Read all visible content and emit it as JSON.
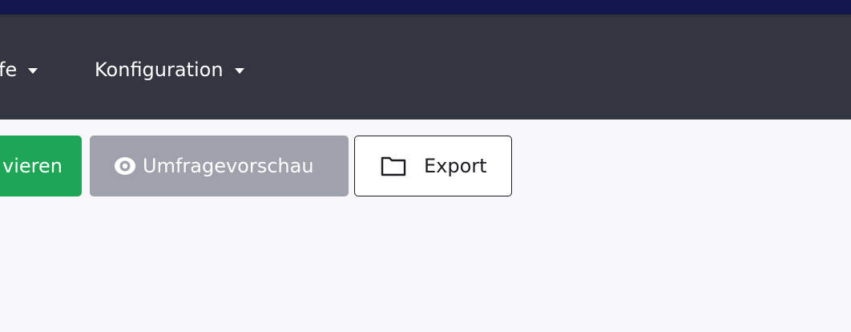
{
  "navbar": {
    "items": [
      {
        "label": "fe"
      },
      {
        "label": "Konfiguration"
      }
    ]
  },
  "toolbar": {
    "activate_label": "vieren",
    "preview_label": "Umfragevorschau",
    "export_label": "Export"
  },
  "colors": {
    "topbar": "#14164f",
    "navbar": "#333641",
    "activate": "#1ea657",
    "preview": "#9fa2ad",
    "background": "#f8f8fb"
  },
  "icons": {
    "preview": "eye-icon",
    "export": "folder-icon",
    "dropdown": "caret-down-icon"
  }
}
